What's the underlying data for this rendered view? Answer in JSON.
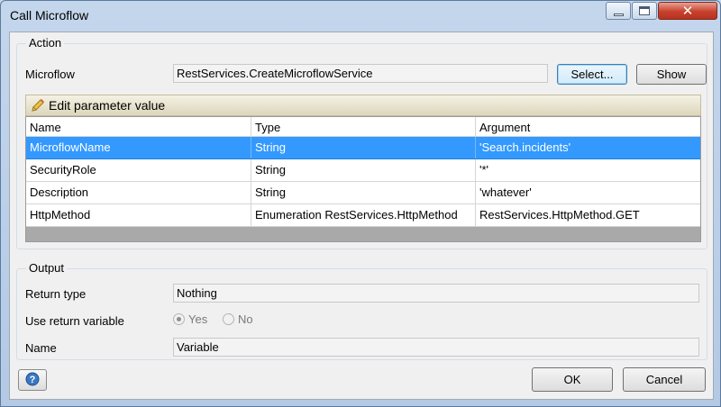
{
  "window": {
    "title": "Call Microflow"
  },
  "titlebar_icons": {
    "minimize": "minimize-icon",
    "maximize": "maximize-icon",
    "close": "close-icon"
  },
  "action": {
    "group_label": "Action",
    "microflow_label": "Microflow",
    "microflow_value": "RestServices.CreateMicroflowService",
    "select_button": "Select...",
    "show_button": "Show",
    "edit_param_label": "Edit parameter value",
    "table": {
      "headers": [
        "Name",
        "Type",
        "Argument"
      ],
      "rows": [
        [
          "MicroflowName",
          "String",
          "'Search.incidents'"
        ],
        [
          "SecurityRole",
          "String",
          "'*'"
        ],
        [
          "Description",
          "String",
          "'whatever'"
        ],
        [
          "HttpMethod",
          "Enumeration RestServices.HttpMethod",
          "RestServices.HttpMethod.GET"
        ]
      ]
    }
  },
  "output": {
    "group_label": "Output",
    "return_type_label": "Return type",
    "return_type_value": "Nothing",
    "use_return_label": "Use return variable",
    "yes_label": "Yes",
    "no_label": "No",
    "name_label": "Name",
    "name_value": "Variable"
  },
  "footer": {
    "ok_button": "OK",
    "cancel_button": "Cancel"
  }
}
